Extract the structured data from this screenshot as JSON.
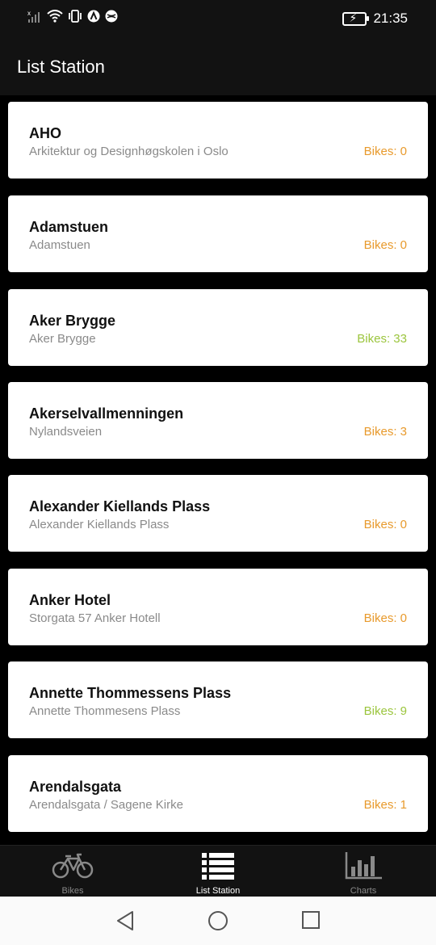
{
  "status_bar": {
    "time": "21:35",
    "icons_left": [
      "signal-icon",
      "wifi-icon",
      "vibrate-icon",
      "app-icon-a",
      "app-icon-b"
    ]
  },
  "app_bar": {
    "title": "List Station"
  },
  "stations": [
    {
      "name": "AHO",
      "address": "Arkitektur og Designhøgskolen i Oslo",
      "bikes": "Bikes: 0",
      "color": "#e89a2c"
    },
    {
      "name": "Adamstuen",
      "address": "Adamstuen",
      "bikes": "Bikes: 0",
      "color": "#e89a2c"
    },
    {
      "name": "Aker Brygge",
      "address": "Aker Brygge",
      "bikes": "Bikes: 33",
      "color": "#9bc53d"
    },
    {
      "name": "Akerselvallmenningen",
      "address": "Nylandsveien",
      "bikes": "Bikes: 3",
      "color": "#e89a2c"
    },
    {
      "name": "Alexander Kiellands Plass",
      "address": "Alexander Kiellands Plass",
      "bikes": "Bikes: 0",
      "color": "#e89a2c"
    },
    {
      "name": "Anker Hotel",
      "address": "Storgata 57 Anker Hotell",
      "bikes": "Bikes: 0",
      "color": "#e89a2c"
    },
    {
      "name": "Annette Thommessens Plass",
      "address": "Annette Thommesens Plass",
      "bikes": "Bikes: 9",
      "color": "#9bc53d"
    },
    {
      "name": "Arendalsgata",
      "address": "Arendalsgata / Sagene Kirke",
      "bikes": "Bikes: 1",
      "color": "#e89a2c"
    }
  ],
  "bottom_nav": [
    {
      "label": "Bikes",
      "icon": "bicycle-icon",
      "active": false
    },
    {
      "label": "List Station",
      "icon": "list-icon",
      "active": true
    },
    {
      "label": "Charts",
      "icon": "bar-chart-icon",
      "active": false
    }
  ],
  "system_nav": [
    "back-icon",
    "home-icon",
    "recents-icon"
  ],
  "colors": {
    "active": "#ffffff",
    "inactive": "#8a8a8a",
    "orange": "#e89a2c",
    "green": "#9bc53d"
  }
}
